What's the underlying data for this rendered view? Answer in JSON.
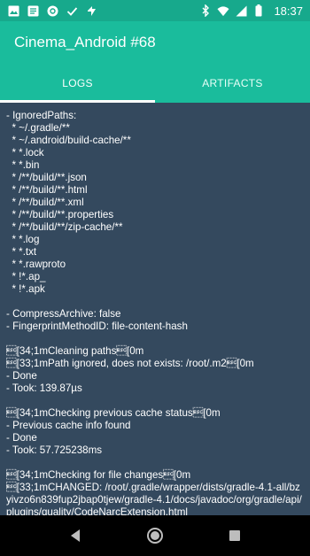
{
  "status_bar": {
    "time": "18:37",
    "left_icons": [
      "image-icon",
      "notification-box-icon",
      "circle-app-icon",
      "check-icon",
      "flash-icon"
    ],
    "right_icons": [
      "bluetooth-icon",
      "wifi-icon",
      "signal-icon",
      "battery-icon"
    ]
  },
  "app_bar": {
    "title": "Cinema_Android #68"
  },
  "tabs": [
    {
      "label": "LOGS",
      "active": true
    },
    {
      "label": "ARTIFACTS",
      "active": false
    }
  ],
  "log": {
    "lines": [
      "- IgnoredPaths:",
      "  * ~/.gradle/**",
      "  * ~/.android/build-cache/**",
      "  * *.lock",
      "  * *.bin",
      "  * /**/build/**.json",
      "  * /**/build/**.html",
      "  * /**/build/**.xml",
      "  * /**/build/**.properties",
      "  * /**/build/**/zip-cache/**",
      "  * *.log",
      "  * *.txt",
      "  * *.rawproto",
      "  * !*.ap_",
      "  * !*.apk",
      "",
      "- CompressArchive: false",
      "- FingerprintMethodID: file-content-hash",
      "",
      "\u001b[34;1mCleaning paths\u001b[0m",
      "\u001b[33;1mPath ignored, does not exists: /root/.m2\u001b[0m",
      "- Done",
      "- Took: 139.87µs",
      "",
      "\u001b[34;1mChecking previous cache status\u001b[0m",
      "- Previous cache info found",
      "- Done",
      "- Took: 57.725238ms",
      "",
      "\u001b[34;1mChecking for file changes\u001b[0m",
      "\u001b[33;1mCHANGED: /root/.gradle/wrapper/dists/gradle-4.1-all/bzyivzo6n839fup2jbap0tjew/gradle-4.1/docs/javadoc/org/gradle/api/plugins/quality/CodeNarcExtension.html"
    ]
  },
  "nav_bar": {
    "buttons": [
      "back-icon",
      "home-icon",
      "recents-icon"
    ]
  },
  "colors": {
    "status_bar": "#17a98c",
    "app_bar": "#1abc9c",
    "log_background": "#34495e",
    "log_text": "#ffffff"
  }
}
